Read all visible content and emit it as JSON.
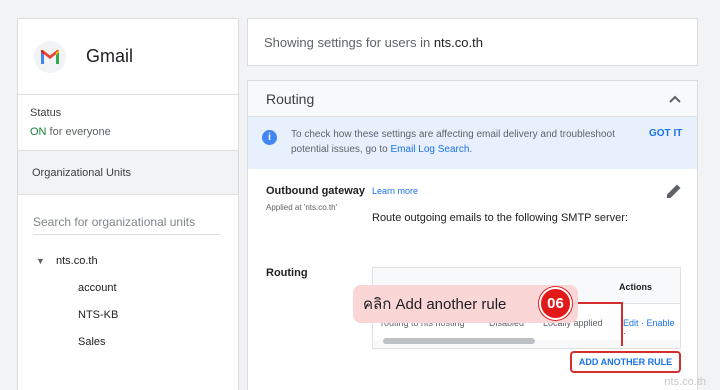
{
  "app": {
    "name": "Gmail",
    "logo_icon": "gmail-logo-icon"
  },
  "status": {
    "label": "Status",
    "on": "ON",
    "suffix": " for everyone"
  },
  "ou": {
    "title": "Organizational Units",
    "search_placeholder": "Search for organizational units",
    "root": "nts.co.th",
    "children": [
      "account",
      "NTS-KB",
      "Sales"
    ]
  },
  "header": {
    "prefix": "Showing settings for users in ",
    "domain": "nts.co.th"
  },
  "routing": {
    "title": "Routing",
    "info": {
      "text": "To check how these settings are affecting email delivery and troubleshoot potential issues, go to ",
      "link": "Email Log Search",
      "after": ".",
      "gotit": "GOT IT"
    },
    "gateway": {
      "title": "Outbound gateway",
      "sub": "Applied at 'nts.co.th'",
      "learn": "Learn more",
      "text": "Route outgoing emails to the following SMTP server:"
    },
    "routing_label": "Routing",
    "table": {
      "actions_header": "Actions",
      "row": {
        "name": "routing to nts hosting",
        "status": "Disabled",
        "scope": "Locally applied",
        "actions": "Edit · Enable ·"
      }
    },
    "add_rule": "ADD ANOTHER RULE"
  },
  "callout": {
    "text": "คลิก Add another rule",
    "step": "06"
  },
  "watermark": "nts.co.th",
  "colors": {
    "accent": "#1a73e8",
    "callout_red": "#e11919",
    "on_green": "#188038"
  }
}
